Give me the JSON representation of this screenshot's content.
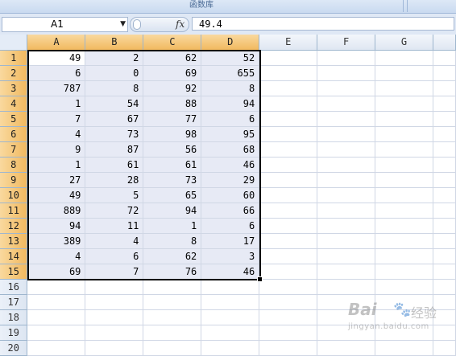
{
  "ribbon": {
    "group_label": "函数库"
  },
  "name_box": {
    "value": "A1"
  },
  "formula_bar": {
    "fx_label": "fx",
    "value": "49.4"
  },
  "columns": [
    "A",
    "B",
    "C",
    "D",
    "E",
    "F",
    "G"
  ],
  "selected_columns": [
    "A",
    "B",
    "C",
    "D"
  ],
  "rows": [
    {
      "n": "1",
      "cells": [
        "49",
        "2",
        "62",
        "52"
      ]
    },
    {
      "n": "2",
      "cells": [
        "6",
        "0",
        "69",
        "655"
      ]
    },
    {
      "n": "3",
      "cells": [
        "787",
        "8",
        "92",
        "8"
      ]
    },
    {
      "n": "4",
      "cells": [
        "1",
        "54",
        "88",
        "94"
      ]
    },
    {
      "n": "5",
      "cells": [
        "7",
        "67",
        "77",
        "6"
      ]
    },
    {
      "n": "6",
      "cells": [
        "4",
        "73",
        "98",
        "95"
      ]
    },
    {
      "n": "7",
      "cells": [
        "9",
        "87",
        "56",
        "68"
      ]
    },
    {
      "n": "8",
      "cells": [
        "1",
        "61",
        "61",
        "46"
      ]
    },
    {
      "n": "9",
      "cells": [
        "27",
        "28",
        "73",
        "29"
      ]
    },
    {
      "n": "10",
      "cells": [
        "49",
        "5",
        "65",
        "60"
      ]
    },
    {
      "n": "11",
      "cells": [
        "889",
        "72",
        "94",
        "66"
      ]
    },
    {
      "n": "12",
      "cells": [
        "94",
        "11",
        "1",
        "6"
      ]
    },
    {
      "n": "13",
      "cells": [
        "389",
        "4",
        "8",
        "17"
      ]
    },
    {
      "n": "14",
      "cells": [
        "4",
        "6",
        "62",
        "3"
      ]
    },
    {
      "n": "15",
      "cells": [
        "69",
        "7",
        "76",
        "46"
      ]
    },
    {
      "n": "16",
      "cells": [
        "",
        "",
        "",
        ""
      ]
    },
    {
      "n": "17",
      "cells": [
        "",
        "",
        "",
        ""
      ]
    },
    {
      "n": "18",
      "cells": [
        "",
        "",
        "",
        ""
      ]
    },
    {
      "n": "19",
      "cells": [
        "",
        "",
        "",
        ""
      ]
    },
    {
      "n": "20",
      "cells": [
        "",
        "",
        "",
        ""
      ]
    }
  ],
  "selected_rows_count": 15,
  "watermark": {
    "logo": "Bai",
    "cn": "经验",
    "url": "jingyan.baidu.com"
  },
  "colors": {
    "header_selected": "#f1b95f",
    "selection_fill": "#e7eaf5",
    "grid_line": "#d0d7e5"
  }
}
